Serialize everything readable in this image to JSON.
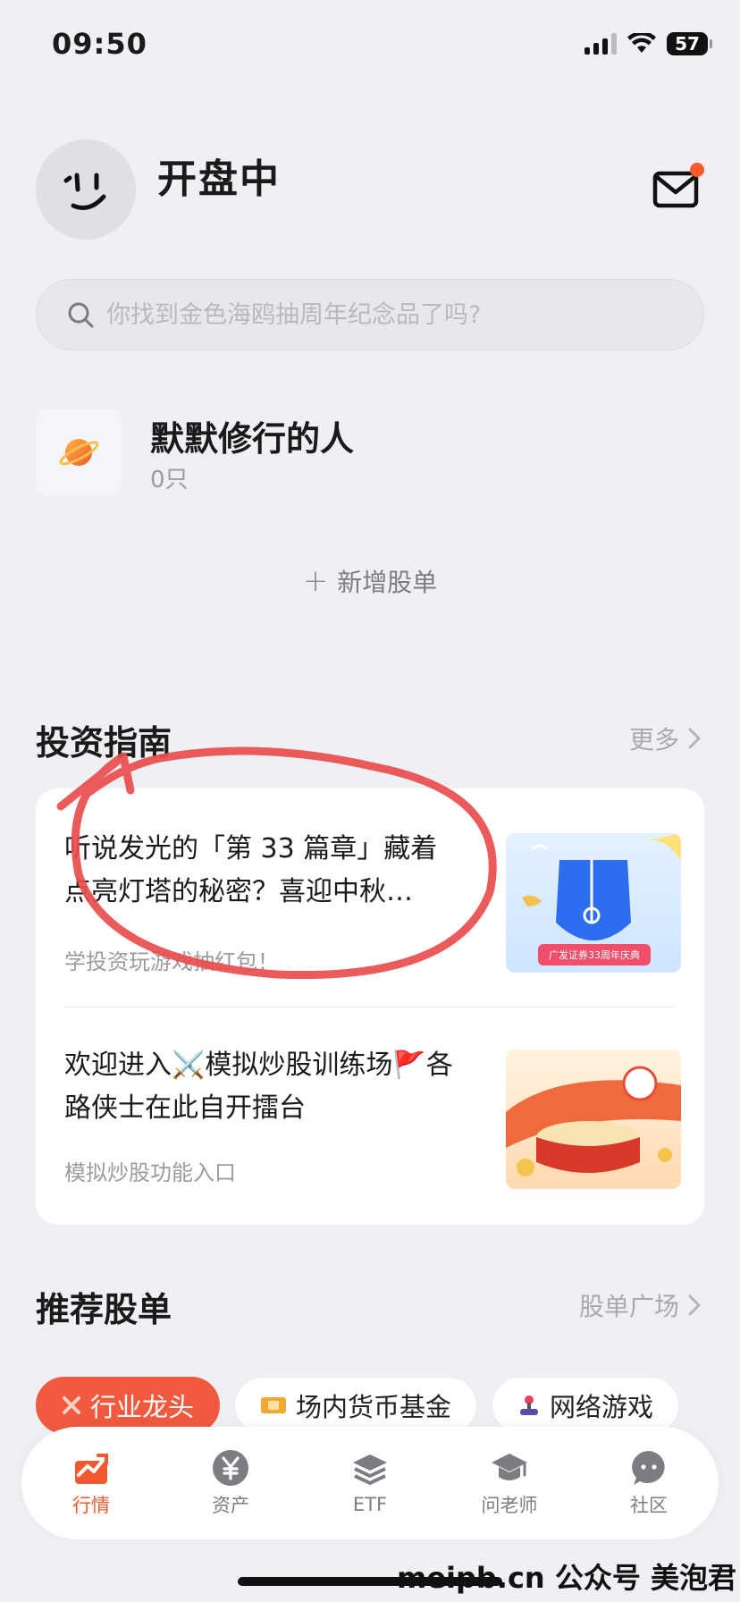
{
  "status_bar": {
    "time": "09:50",
    "battery": "57"
  },
  "header": {
    "market_status": "开盘中"
  },
  "search": {
    "placeholder": "你找到金色海鸥抽周年纪念品了吗?"
  },
  "watchlist": {
    "name": "默默修行的人",
    "count": "0只",
    "add_label": "新增股单"
  },
  "guide": {
    "title": "投资指南",
    "more_label": "更多",
    "articles": [
      {
        "title": "听说发光的「第 33 篇章」藏着点亮灯塔的秘密？喜迎中秋…",
        "subtitle": "学投资玩游戏抽红包！",
        "thumb_caption": "广发证券33周年庆典"
      },
      {
        "title": "欢迎进入⚔️模拟炒股训练场🚩各路侠士在此自开擂台",
        "subtitle": "模拟炒股功能入口"
      }
    ]
  },
  "recommended": {
    "title": "推荐股单",
    "more_label": "股单广场",
    "chips": [
      {
        "label": "行业龙头",
        "active": true
      },
      {
        "label": "场内货币基金",
        "active": false
      },
      {
        "label": "网络游戏",
        "active": false
      }
    ]
  },
  "tab_bar": {
    "tabs": [
      {
        "label": "行情",
        "icon": "market-icon"
      },
      {
        "label": "资产",
        "icon": "yuan-icon"
      },
      {
        "label": "ETF",
        "icon": "layers-icon"
      },
      {
        "label": "问老师",
        "icon": "grad-cap-icon"
      },
      {
        "label": "社区",
        "icon": "chat-icon"
      }
    ],
    "active_color": "#f05a2f"
  },
  "watermark": "meipb.cn  公众号 美泡君",
  "colors": {
    "accent": "#f15a3e",
    "annotation": "#ea4d4d"
  }
}
